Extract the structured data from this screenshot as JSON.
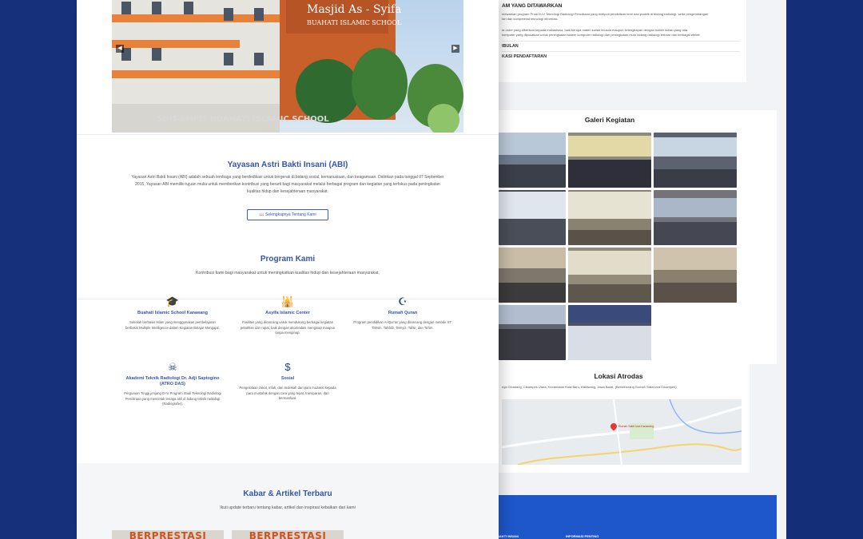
{
  "right_page": {
    "top_heading": "AM YANG DITAWARKAN",
    "top_p1": "mewarkan program Prodi D-IV Teknologi Radiologi Pencitraan yang meliputi pendidikan teori dan praktik di bidang radiologi, serta pengembangan",
    "top_p1b": "tan dan kompetensi teknologi informasi.",
    "top_p2": "ta order yang diberikan kepada mahasiswa, baik berupa materi kuliah khusus maupun kelengkapan dengan materi kuliah yang ada.",
    "top_p2b": "komputer yang dipusatkan untuk peningkatan sistem komputer radiologi dan peningkatan mutu bidang radiologi terbaru dan berbagai efektif.",
    "row1": "IBULAN",
    "row2": "KASI PENDAFTARAN",
    "gallery_title": "Galeri Kegiatan",
    "location_title": "Lokasi Atrodas",
    "location_address": "nya Cibadang, Cikampek Utara, Kecamatan Kota Baru, Karawang, Jawa Barat, (Berseberang Rumah Sakit Izza Cikampek)",
    "map_label": "Rumah Sakit Izza Karawang",
    "footer_left": "BAKTI INSANI",
    "footer_right": "INFORMASI PENTING"
  },
  "hero": {
    "sign_line1": "Masjid As - Syifa",
    "sign_line2": "BUAHATI ISLAMIC SCHOOL",
    "bottom_sign": "SDIT-SMPIT BUAHATI ISLAMIC SCHOOL",
    "prev_glyph": "◀",
    "next_glyph": "▶"
  },
  "about": {
    "title": "Yayasan Astri Bakti Insani (ABI)",
    "text": "Yayasan Astri Bakti Insani (ABI) adalah sebuah lembaga yang berdedikasi untuk bergerak di bidang sosial, kemanusiaan, dan keagamaan. Didirikan pada tanggal 07 September 2015, Yayasan ABI memiliki tujuan mulia untuk memberikan kontribusi yang berarti bagi masyarakat melalui berbagai program dan kegiatan yang terfokus pada peningkatan kualitas hidup dan kesejahteraan masyarakat.",
    "button": "📖 Selengkapnya Tentang Kami"
  },
  "programs": {
    "title": "Program Kami",
    "subtitle": "Kontribusi kami bagi masyarakat untuk meningkatkan kualitas hidup dan kesejahteraan masyarakat.",
    "items": [
      {
        "icon": "graduation-cap-icon",
        "glyph": "🎓",
        "name": "Buahati Islamic School Karawang",
        "desc": "Sekolah berbasis Islam yang menggunakan pembelajaran berbasis Multiple Intelligence dalam Kegiatan Belajar Mengajar."
      },
      {
        "icon": "mosque-icon",
        "glyph": "🕌",
        "name": "Asyifa Islamic Center",
        "desc": "Fasilitas yang dirancang untuk mendukung berbagai kegiatan pelatihan dan rapat, baik dengan akomodasi menginap maupun tanpa menginap."
      },
      {
        "icon": "quran-icon",
        "glyph": "☪",
        "name": "Rumah Quran",
        "desc": "Program pendidikan Al-Qur'an yang dirancang dengan metode ST: Tahsin, Tahfidz, Tarnyiz, Tafsir, dan Ta'lim."
      },
      {
        "icon": "xray-icon",
        "glyph": "☠",
        "name": "Akademi Teknik Radiologi Dr. Adji Saptogino (ATRO DAS)",
        "desc": "Perguruan Tinggi jenjang D-IV Program Studi Teknologi Radiologi Pencitraan yang mencetak tenaga ahli di bidang teknik radiologi (Radiografer)."
      },
      {
        "icon": "money-bag-icon",
        "glyph": "$",
        "name": "Sosial",
        "desc": "Pengelolaan zakat, infak, dan sedekah dari para muzakki kepada para mustahik dengan cara yang tepat, transparan, dan bermanfaat."
      }
    ]
  },
  "news": {
    "title": "Kabar & Artikel Terbaru",
    "subtitle": "Ikuti update terbaru tentang kabar, artikel dan inspirasi kebaikan dari kami",
    "card1": "BERPRESTASI",
    "card2": "BERPRESTASI"
  }
}
